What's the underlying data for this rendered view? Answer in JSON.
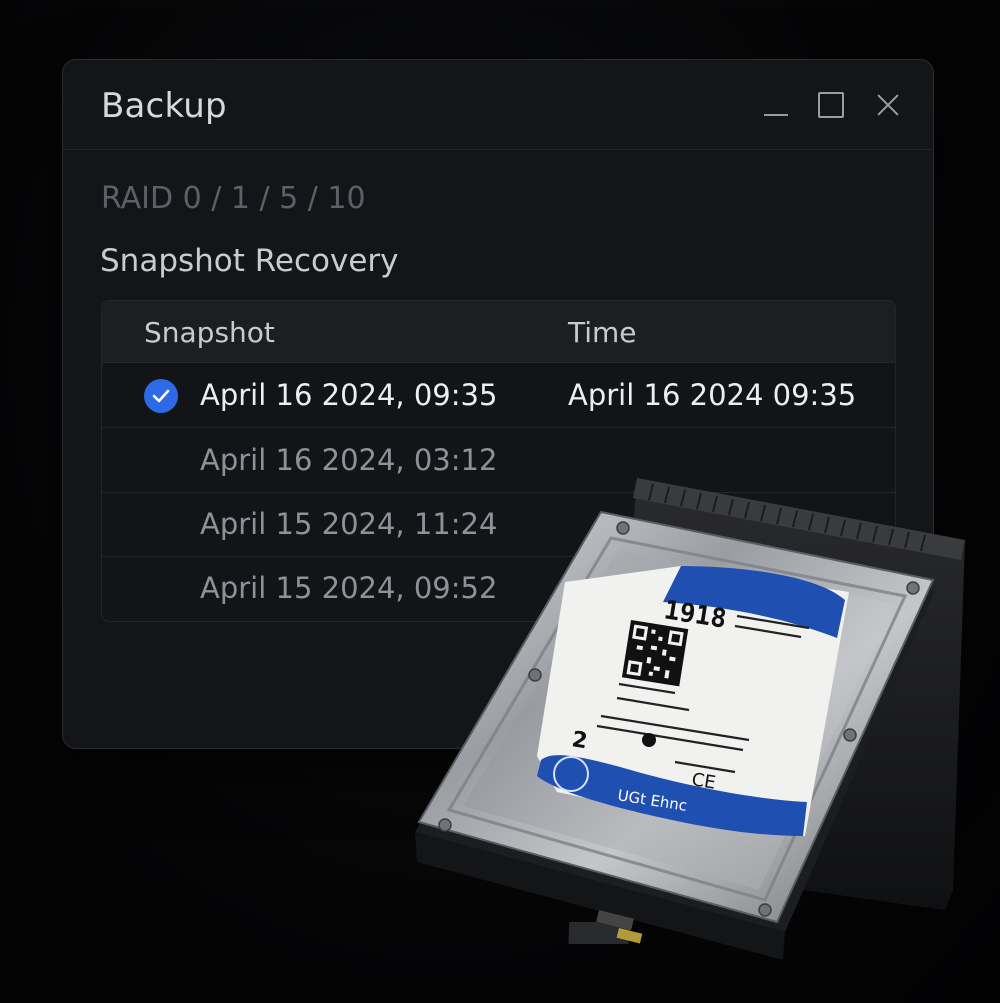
{
  "window": {
    "title": "Backup",
    "controls": {
      "minimize": "minimize-icon",
      "maximize": "maximize-icon",
      "close": "close-icon"
    }
  },
  "raid_levels": "RAID 0 / 1 / 5 / 10",
  "section_heading": "Snapshot Recovery",
  "table": {
    "columns": [
      "Snapshot",
      "Time"
    ],
    "rows": [
      {
        "snapshot": "April 16 2024, 09:35",
        "time": "April 16 2024 09:35",
        "selected": true
      },
      {
        "snapshot": "April 16 2024, 03:12",
        "time": "",
        "selected": false
      },
      {
        "snapshot": "April 15 2024, 11:24",
        "time": "",
        "selected": false
      },
      {
        "snapshot": "April 15 2024, 09:52",
        "time": "",
        "selected": false
      }
    ]
  },
  "drive_label": {
    "model": "1918",
    "brand": "UGt Ehnc",
    "capacity_mark": "2",
    "ce_mark": "CE"
  },
  "colors": {
    "accent": "#2f6ae6",
    "label_blue": "#1f4fb0",
    "background": "#030304",
    "window": "#141518"
  }
}
